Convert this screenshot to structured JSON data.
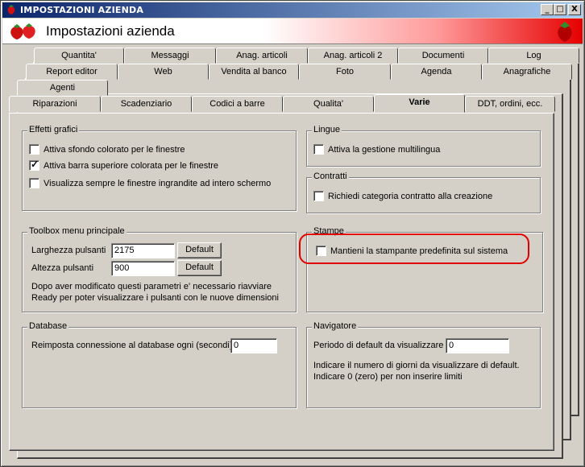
{
  "window": {
    "title": "IMPOSTAZIONI AZIENDA",
    "header_title": "Impostazioni azienda",
    "controls": [
      "_",
      "□",
      "X"
    ]
  },
  "tabs": {
    "row1": [
      "Quantita'",
      "Messaggi",
      "Anag. articoli",
      "Anag. articoli 2",
      "Documenti",
      "Log"
    ],
    "row2": [
      "Report editor",
      "Web",
      "Vendita al banco",
      "Foto",
      "Agenda",
      "Anagrafiche"
    ],
    "row3": [
      "Agenti"
    ],
    "row4": [
      "Riparazioni",
      "Scadenziario",
      "Codici a barre",
      "Qualita'",
      "Varie",
      "DDT, ordini, ecc."
    ],
    "active": "Varie"
  },
  "effetti": {
    "legend": "Effetti grafici",
    "items": [
      {
        "label": "Attiva sfondo colorato per le finestre",
        "checked": false
      },
      {
        "label": "Attiva barra superiore colorata per le finestre",
        "checked": true
      },
      {
        "label": "Visualizza sempre le finestre ingrandite ad intero schermo",
        "checked": false
      }
    ]
  },
  "lingue": {
    "legend": "Lingue",
    "item": {
      "label": "Attiva la gestione multilingua",
      "checked": false
    }
  },
  "contratti": {
    "legend": "Contratti",
    "item": {
      "label": "Richiedi categoria contratto alla creazione",
      "checked": false
    }
  },
  "toolbox": {
    "legend": "Toolbox menu principale",
    "larghezza_label": "Larghezza pulsanti",
    "larghezza_value": "2175",
    "altezza_label": "Altezza pulsanti",
    "altezza_value": "900",
    "default_label": "Default",
    "note_line1": "Dopo aver modificato questi parametri e' necessario riavviare",
    "note_line2": "Ready per poter visualizzare i pulsanti con le nuove dimensioni"
  },
  "stampe": {
    "legend": "Stampe",
    "item": {
      "label": "Mantieni la stampante predefinita sul sistema",
      "checked": false
    },
    "highlight_color": "#e00000"
  },
  "database": {
    "legend": "Database",
    "label": "Reimposta connessione al database ogni (secondi)",
    "value": "0"
  },
  "navigatore": {
    "legend": "Navigatore",
    "label": "Periodo di default da visualizzare",
    "value": "0",
    "note_line1": "Indicare il numero di giorni da visualizzare di default.",
    "note_line2": "Indicare 0 (zero) per non inserire limiti"
  },
  "icons": [
    "strawberry-icon",
    "minimize-icon",
    "maximize-icon",
    "close-icon",
    "checkmark-icon"
  ],
  "colors": {
    "title_bar": "#0a246a",
    "face": "#d4d0c8",
    "header_red": "#e60000"
  }
}
